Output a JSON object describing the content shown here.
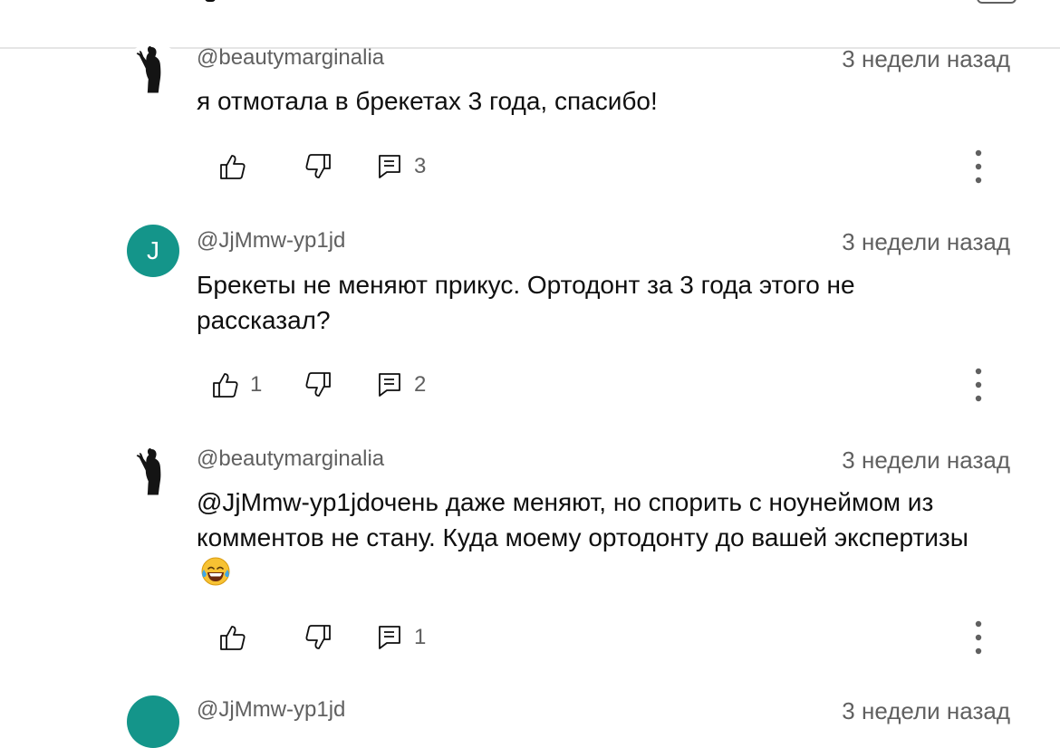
{
  "comments": [
    {
      "author": "@beautymarginalia",
      "avatar_type": "photo",
      "time": "3 недели назад",
      "text": "я отмотала в брекетах 3 года, спасибо!",
      "likes": "",
      "replies": "3"
    },
    {
      "author": "@JjMmw-yp1jd",
      "avatar_type": "letter",
      "avatar_letter": "J",
      "avatar_color": "#14958a",
      "time": "3 недели назад",
      "text": "Брекеты не меняют прикус. Ортодонт  за 3 года этого не рассказал?",
      "likes": "1",
      "replies": "2"
    },
    {
      "author": "@beautymarginalia",
      "avatar_type": "photo",
      "time": "3 недели назад",
      "text": "@JjMmw-yp1jdочень даже меняют, но спорить с ноунеймом из комментов не стану. Куда моему ортодонту до вашей экспертизы",
      "emoji": "face-with-tears-of-joy",
      "likes": "",
      "replies": "1"
    },
    {
      "author": "@JjMmw-yp1jd",
      "avatar_type": "letter",
      "avatar_letter": "",
      "avatar_color": "#14958a",
      "time": "3 недели назад",
      "text": "",
      "partial": true
    }
  ],
  "icons": {
    "like": "thumb-up-icon",
    "dislike": "thumb-down-icon",
    "reply": "reply-comment-icon",
    "more": "more-vert-icon"
  }
}
